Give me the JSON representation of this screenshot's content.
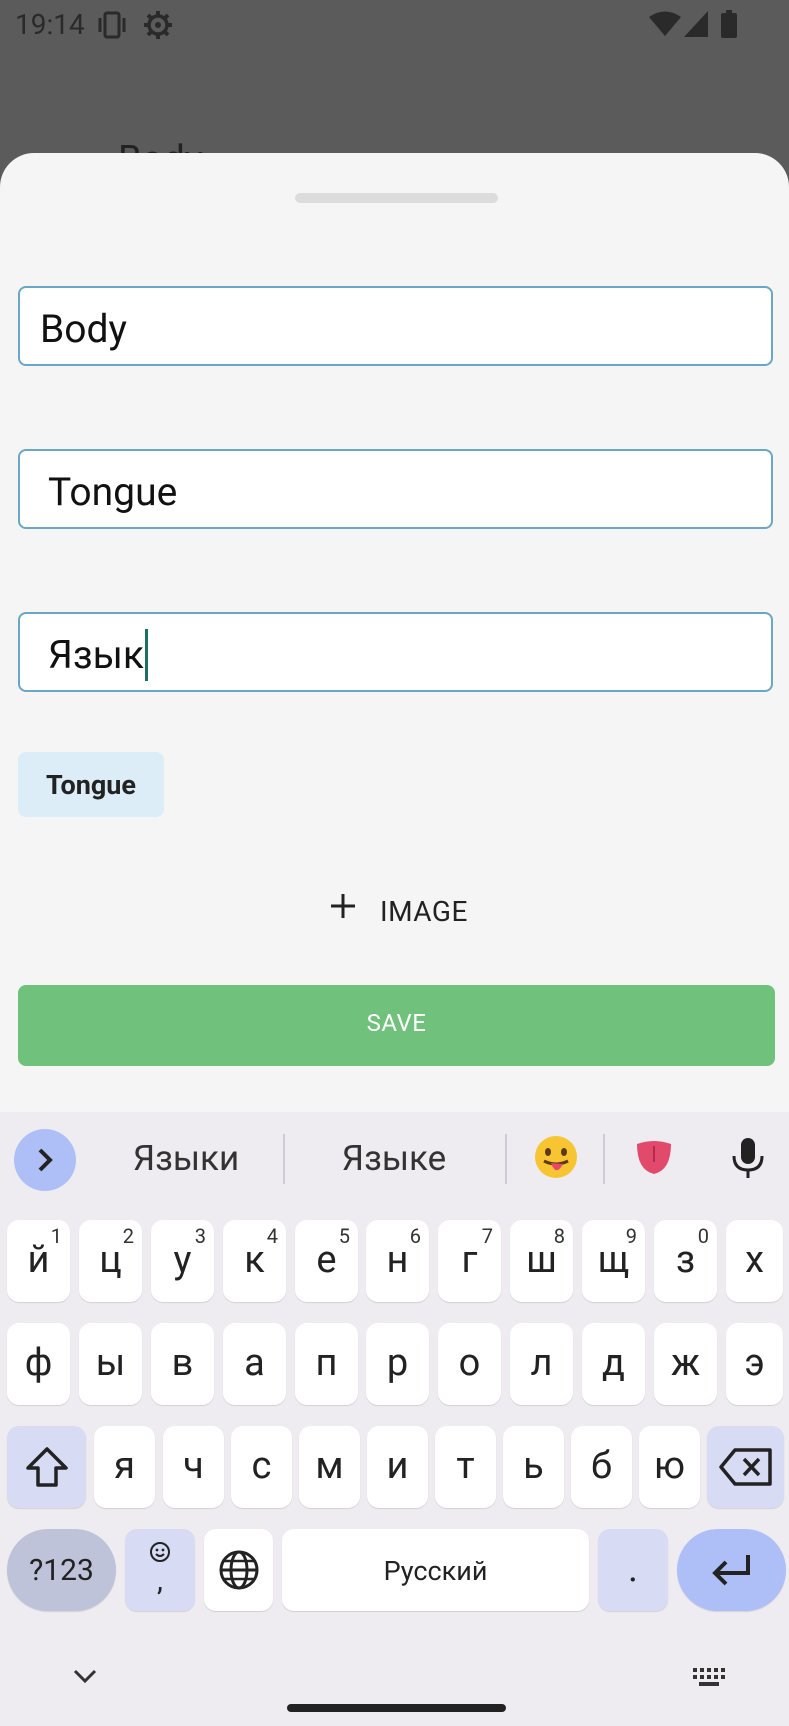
{
  "status_bar": {
    "time": "19:14"
  },
  "behind": {
    "partial_text": "Body"
  },
  "form": {
    "field1_value": "Body",
    "field2_value": "Tongue",
    "field3_value": "Язык",
    "chip_label": "Tongue",
    "image_button_label": "IMAGE",
    "save_label": "SAVE"
  },
  "keyboard": {
    "suggestions": [
      "Языки",
      "Языке"
    ],
    "row1": [
      [
        "й",
        "1"
      ],
      [
        "ц",
        "2"
      ],
      [
        "у",
        "3"
      ],
      [
        "к",
        "4"
      ],
      [
        "е",
        "5"
      ],
      [
        "н",
        "6"
      ],
      [
        "г",
        "7"
      ],
      [
        "ш",
        "8"
      ],
      [
        "щ",
        "9"
      ],
      [
        "з",
        "0"
      ],
      [
        "х",
        ""
      ]
    ],
    "row2": [
      "ф",
      "ы",
      "в",
      "а",
      "п",
      "р",
      "о",
      "л",
      "д",
      "ж",
      "э"
    ],
    "row3": [
      "я",
      "ч",
      "с",
      "м",
      "и",
      "т",
      "ь",
      "б",
      "ю"
    ],
    "symbols_label": "?123",
    "comma_label": ",",
    "space_label": "Русский",
    "period_label": "."
  },
  "colors": {
    "field_border": "#6aa7c4",
    "save_bg": "#6fc17c",
    "chip_bg": "#dcedf8",
    "cursor": "#1d6f66",
    "accent_key": "#aebff7"
  }
}
